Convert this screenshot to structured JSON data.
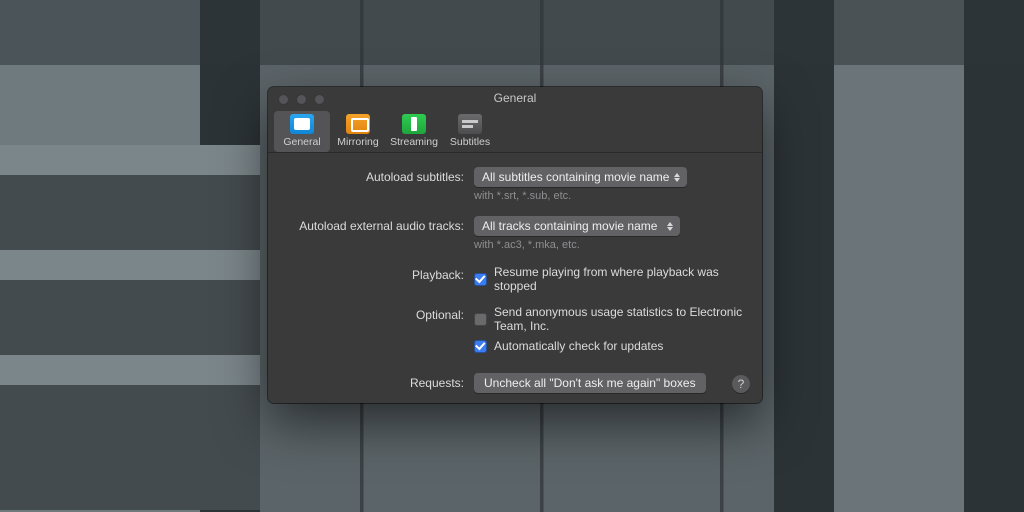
{
  "window": {
    "title": "General"
  },
  "toolbar": {
    "items": [
      {
        "label": "General"
      },
      {
        "label": "Mirroring"
      },
      {
        "label": "Streaming"
      },
      {
        "label": "Subtitles"
      }
    ]
  },
  "form": {
    "autoload_subtitles": {
      "label": "Autoload subtitles:",
      "value": "All subtitles containing movie name",
      "hint": "with *.srt, *.sub, etc."
    },
    "autoload_audio": {
      "label": "Autoload external audio tracks:",
      "value": "All tracks containing movie name",
      "hint": "with *.ac3, *.mka, etc."
    },
    "playback": {
      "label": "Playback:",
      "resume": "Resume playing from where playback was stopped"
    },
    "optional": {
      "label": "Optional:",
      "stats": "Send anonymous usage statistics to Electronic Team, Inc.",
      "updates": "Automatically check for updates"
    },
    "requests": {
      "label": "Requests:",
      "button": "Uncheck all \"Don't ask me again\" boxes"
    }
  },
  "help": {
    "symbol": "?"
  }
}
